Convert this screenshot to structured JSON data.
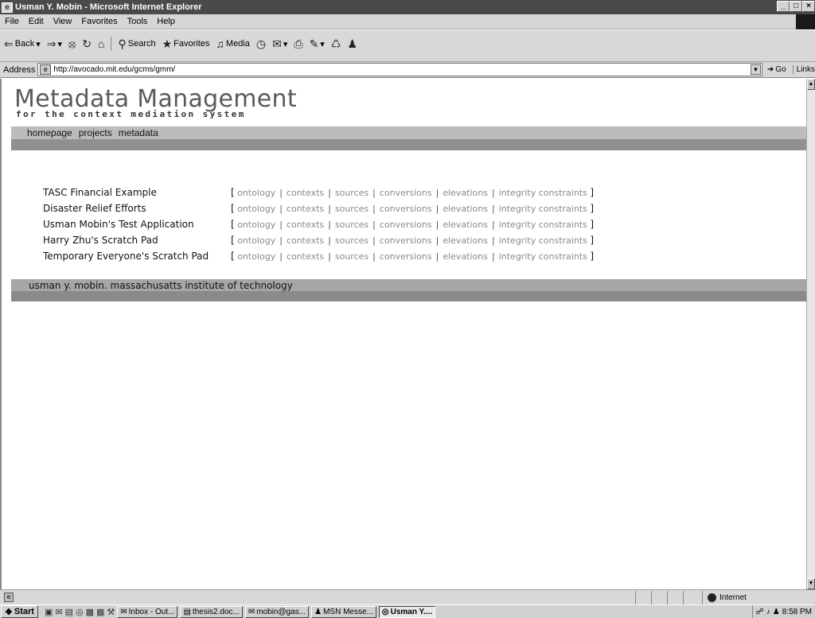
{
  "window": {
    "title": "Usman Y. Mobin - Microsoft Internet Explorer",
    "minimize": "_",
    "restore": "0",
    "close": "×"
  },
  "menu": [
    "File",
    "Edit",
    "View",
    "Favorites",
    "Tools",
    "Help"
  ],
  "toolbar": {
    "back": "Back",
    "search": "Search",
    "favorites": "Favorites",
    "media": "Media"
  },
  "address": {
    "label": "Address",
    "url": "http://avocado.mit.edu/gcms/gmm/",
    "go": "Go",
    "links": "Links"
  },
  "page": {
    "title": "Metadata Management",
    "subtitle": "for the context mediation system",
    "nav": [
      "homepage",
      "projects",
      "metadata"
    ],
    "projects": [
      {
        "name": "TASC Financial Example"
      },
      {
        "name": "Disaster Relief Efforts"
      },
      {
        "name": "Usman Mobin's Test Application"
      },
      {
        "name": "Harry Zhu's Scratch Pad"
      },
      {
        "name": "Temporary Everyone's Scratch Pad"
      }
    ],
    "link_labels": [
      "ontology",
      "contexts",
      "sources",
      "conversions",
      "elevations",
      "integrity constraints"
    ],
    "bracket_open": "[",
    "bracket_close": "]",
    "separator": "|",
    "footer": "usman y. mobin. massachusatts institute of technology"
  },
  "status": {
    "zone": "Internet"
  },
  "taskbar": {
    "start": "Start",
    "tasks": [
      "Inbox - Out...",
      "thesis2.doc...",
      "mobin@gas...",
      "MSN Messe...",
      "Usman Y...."
    ],
    "active_task_index": 4,
    "clock": "8:58 PM"
  }
}
